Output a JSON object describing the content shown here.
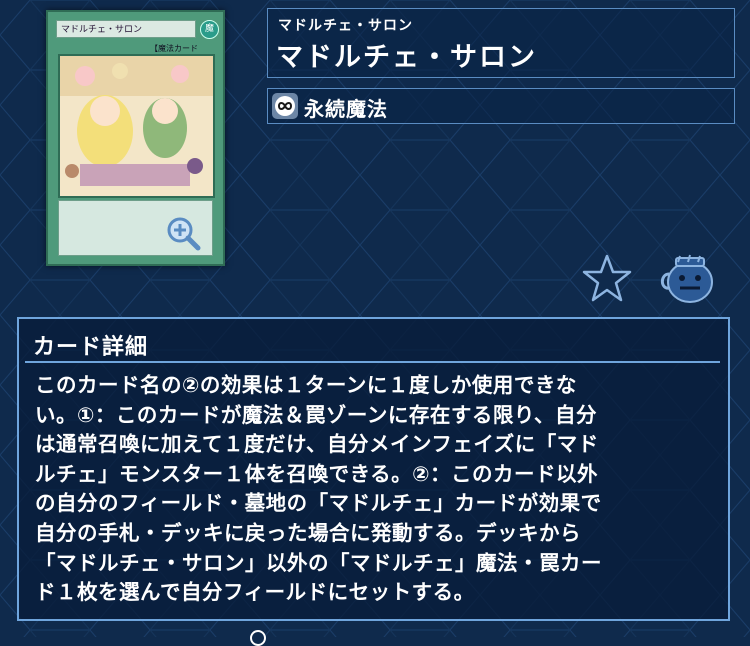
{
  "card": {
    "name": "マドルチェ・サロン",
    "name_ruby": "マドルチェ・サロン",
    "card_type_line": "【魔法カード",
    "spell_type": "永続魔法"
  },
  "detail": {
    "heading": "カード詳細",
    "lines": [
      "このカード名の②の効果は１ターンに１度しか使用できな",
      "い。①：このカードが魔法＆罠ゾーンに存在する限り、自分",
      "は通常召喚に加えて１度だけ、自分メインフェイズに「マド",
      "ルチェ」モンスター１体を召喚できる。②：このカード以外",
      "の自分のフィールド・墓地の「マドルチェ」カードが効果で",
      "自分の手札・デッキに戻った場合に発動する。デッキから",
      "「マドルチェ・サロン」以外の「マドルチェ」魔法・罠カー",
      "ド１枚を選んで自分フィールドにセットする。"
    ]
  },
  "icons": {
    "zoom": "zoom-in-icon",
    "spell_type": "continuous-spell-icon",
    "favorite": "star-icon",
    "deck": "pot-icon",
    "attribute": "spell-attribute-icon"
  },
  "colors": {
    "background": "#0f2a4c",
    "panel_border": "#6fa5dd",
    "card_frame": "#4f9a7b"
  }
}
